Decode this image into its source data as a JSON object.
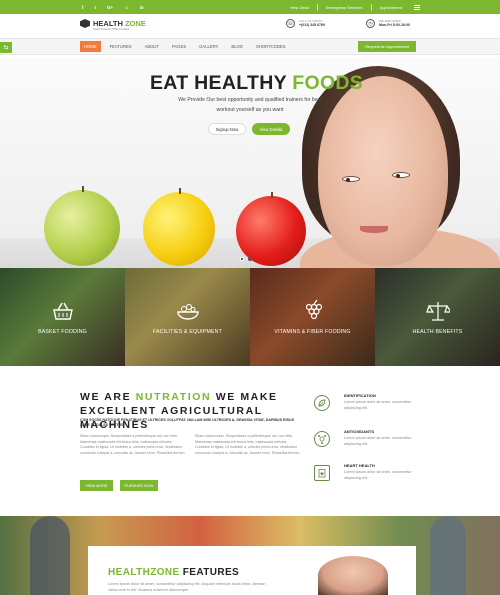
{
  "topbar": {
    "social": [
      "f",
      "t",
      "G+",
      "☺",
      "in"
    ],
    "links": [
      "Help Desk",
      "Emergency Services",
      "Appointment"
    ]
  },
  "header": {
    "logo_main": "HEALTH",
    "logo_accent": "ZONE",
    "logo_sub": "Health & Beauty HTML Template",
    "contact1": {
      "label": "CALL US TODAY!",
      "value": "+(012) 345 6789"
    },
    "contact2": {
      "label": "WE ARE OPEN!",
      "value": "Mon-Fri 8:00-16:00"
    }
  },
  "nav": {
    "items": [
      "HOME",
      "FEATURES",
      "ABOUT",
      "PAGES",
      "GALLERY",
      "BLOG",
      "SHORTCODES"
    ],
    "appointment": "Request an Appointment"
  },
  "hero": {
    "title_main": "EAT HEALTHY ",
    "title_accent": "FOODS",
    "text": "We Provide Our best opportunity and qualified trainers for best workout yourself as you want",
    "btn_signup": "Signup Now",
    "btn_details": "View Details"
  },
  "features": [
    {
      "label": "BASKET FOODING",
      "icon": "basket-icon"
    },
    {
      "label": "FACILITIES & EQUIPMENT",
      "icon": "bowl-icon"
    },
    {
      "label": "VITAMINS & FIBER FOODING",
      "icon": "grapes-icon"
    },
    {
      "label": "HEALTH BENEFITS",
      "icon": "scale-icon"
    }
  ],
  "about": {
    "title_a": "WE ARE ",
    "title_accent": "NUTRATION",
    "title_b": " WE MAKE EXCELLENT AGRICULTURAL MACHINES",
    "caps": "CUM SOCIIS NATOQUE PENATIBUS ET ULTRICES VOLUTPAT. NULLAM WISI ULTRICIES A, GRAVIDA VITAE, DAPIBUS RISUS ANTE SODALES LECTUS.",
    "col1": "Etiam ullamcorper. Suspendisse a pellentesque dui, non felis. Maecenas malesuada elit lectus felis, malesuada ultricies. Curabitur et ligula. Ut molestie a, ultricies porta urna. Vestibulum commodo volutpat a, convallis ac, laoreet enim. Phasellus fermen",
    "col2": "Etiam ullamcorper. Suspendisse a pellentesque dui, non felis. Maecenas malesuada elit lectus felis, malesuada ultricies. Curabitur et ligula. Ut molestie a, ultricies porta urna. Vestibulum commodo volutpat a, convallis ac, laoreet enim. Phasellus fermen",
    "btn_view": "VIEW MORE",
    "btn_purchased": "PURSUED NOW"
  },
  "side_items": [
    {
      "title": "IDENTIFICATION",
      "text": "Lorem ipsum dolor sit amet, consectetur adipiscing elit.",
      "icon": "leaf-icon"
    },
    {
      "title": "ANTIOXIDANTS",
      "text": "Lorem ipsum dolor sit amet, consectetur adipiscing elit.",
      "icon": "molecule-icon"
    },
    {
      "title": "HEART HEALTH",
      "text": "Lorem ipsum dolor sit amet, consectetur adipiscing elit.",
      "icon": "clipboard-heart-icon"
    }
  ],
  "bottom": {
    "title_accent": "HEALTHZONE",
    "title_b": " FEATURES",
    "text": "Lorem ipsum dolor sit amet, consectetur adipiscing elit. Aliquam interdum lacus tortor. Aenean varius erat in elit. Vivamus euismod ullamcorper"
  },
  "colors": {
    "accent": "#7cb82f",
    "nav_active": "#ef7c3c"
  }
}
